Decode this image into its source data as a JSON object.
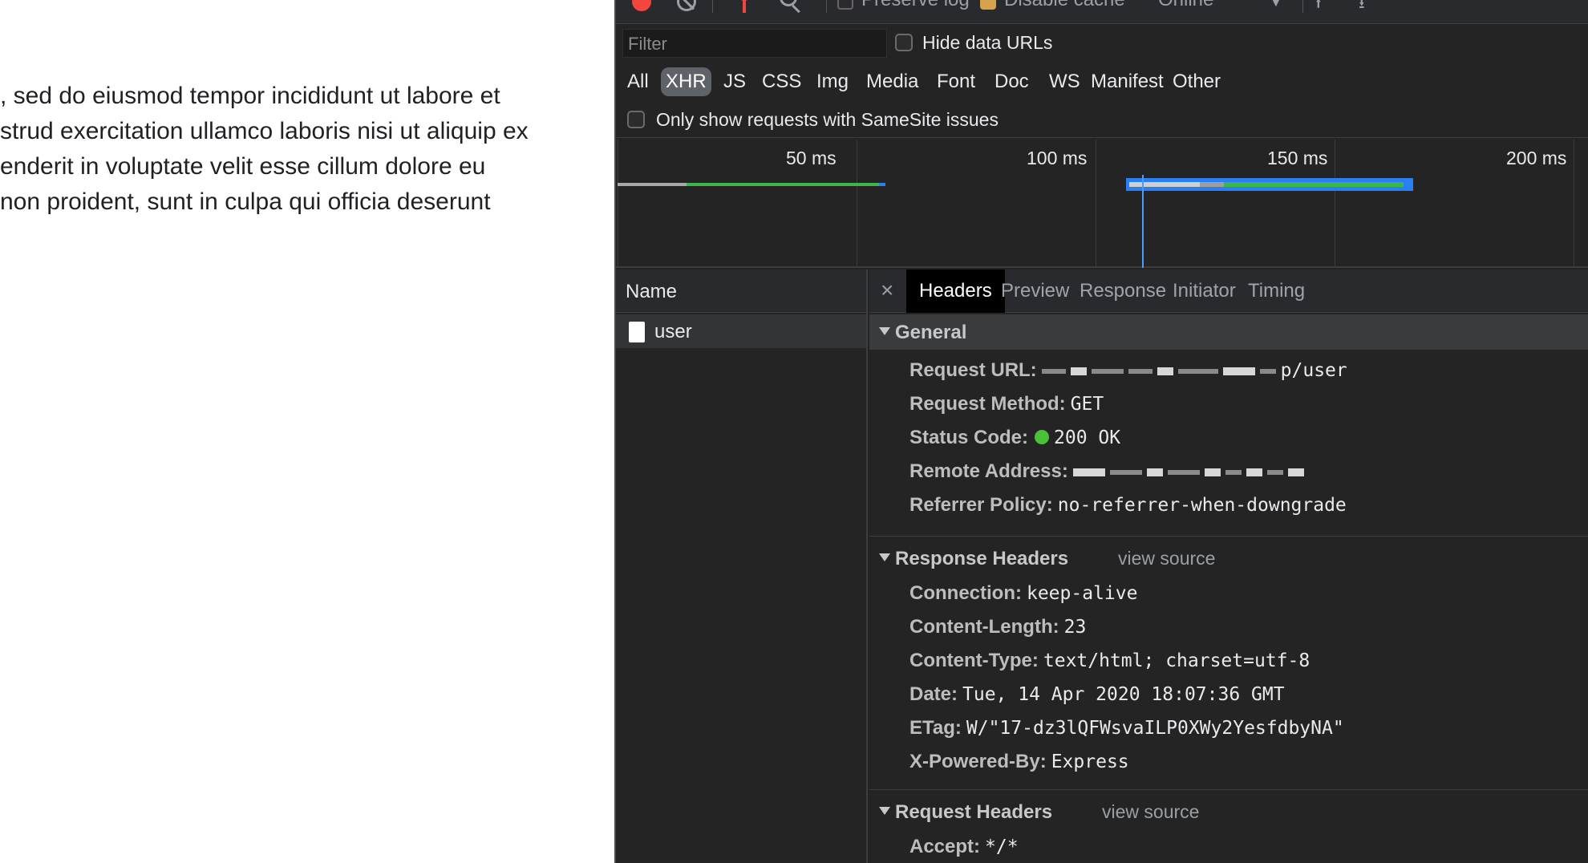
{
  "page": {
    "lines": [
      ", sed do eiusmod tempor incididunt ut labore et",
      "strud exercitation ullamco laboris nisi ut aliquip ex",
      "enderit in voluptate velit esse cillum dolore eu",
      "non proident, sunt in culpa qui officia deserunt"
    ]
  },
  "toolbar": {
    "preserve_log": "Preserve log",
    "disable_cache": "Disable cache",
    "throttle": "Online",
    "preserve_log_checked": false,
    "disable_cache_checked": true
  },
  "filter": {
    "placeholder": "Filter",
    "hide_data_urls": "Hide data URLs"
  },
  "types": [
    "All",
    "XHR",
    "JS",
    "CSS",
    "Img",
    "Media",
    "Font",
    "Doc",
    "WS",
    "Manifest",
    "Other"
  ],
  "active_type": "XHR",
  "samesite_label": "Only show requests with SameSite issues",
  "timeline": {
    "ticks": [
      "50 ms",
      "100 ms",
      "150 ms",
      "200 ms"
    ]
  },
  "requests": {
    "header": "Name",
    "rows": [
      {
        "name": "user"
      }
    ]
  },
  "detail": {
    "tabs": [
      "Headers",
      "Preview",
      "Response",
      "Initiator",
      "Timing"
    ],
    "active_tab": "Headers",
    "view_source": "view source",
    "general": {
      "title": "General",
      "request_url_key": "Request URL:",
      "request_url_suffix": "p/user",
      "request_method_key": "Request Method:",
      "request_method": "GET",
      "status_code_key": "Status Code:",
      "status_code": "200 OK",
      "status_color": "#4cbf3a",
      "remote_address_key": "Remote Address:",
      "referrer_policy_key": "Referrer Policy:",
      "referrer_policy": "no-referrer-when-downgrade"
    },
    "response_headers": {
      "title": "Response Headers",
      "items": [
        {
          "k": "Connection:",
          "v": "keep-alive"
        },
        {
          "k": "Content-Length:",
          "v": "23"
        },
        {
          "k": "Content-Type:",
          "v": "text/html; charset=utf-8"
        },
        {
          "k": "Date:",
          "v": "Tue, 14 Apr 2020 18:07:36 GMT"
        },
        {
          "k": "ETag:",
          "v": "W/\"17-dz3lQFWsvaILP0XWy2YesfdbyNA\""
        },
        {
          "k": "X-Powered-By:",
          "v": "Express"
        }
      ]
    },
    "request_headers": {
      "title": "Request Headers",
      "items": [
        {
          "k": "Accept:",
          "v": "*/*"
        }
      ]
    }
  }
}
